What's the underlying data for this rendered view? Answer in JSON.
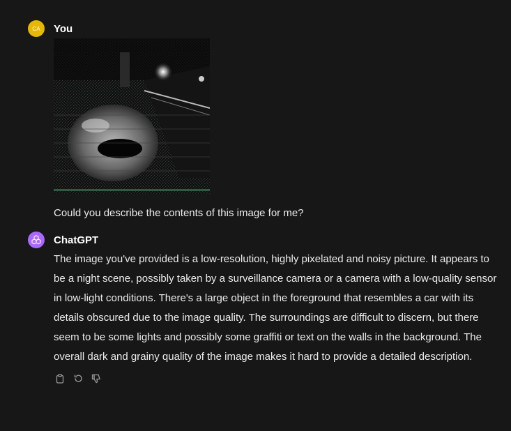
{
  "user_message": {
    "avatar_initials": "CA",
    "author": "You",
    "image_icon": "uploaded-photo",
    "text": "Could you describe the contents of this image for me?"
  },
  "assistant_message": {
    "avatar_icon": "openai-logo-icon",
    "author": "ChatGPT",
    "text": "The image you've provided is a low-resolution, highly pixelated and noisy picture. It appears to be a night scene, possibly taken by a surveillance camera or a camera with a low-quality sensor in low-light conditions. There's a large object in the foreground that resembles a car with its details obscured due to the image quality. The surroundings are difficult to discern, but there seem to be some lights and possibly some graffiti or text on the walls in the background. The overall dark and grainy quality of the image makes it hard to provide a detailed description."
  },
  "actions": {
    "copy_icon": "clipboard-icon",
    "regenerate_icon": "regenerate-icon",
    "dislike_icon": "thumbs-down-icon"
  },
  "colors": {
    "background": "#171717",
    "user_avatar": "#e6b800",
    "assistant_avatar": "#ab68ff",
    "text": "#ececec"
  }
}
